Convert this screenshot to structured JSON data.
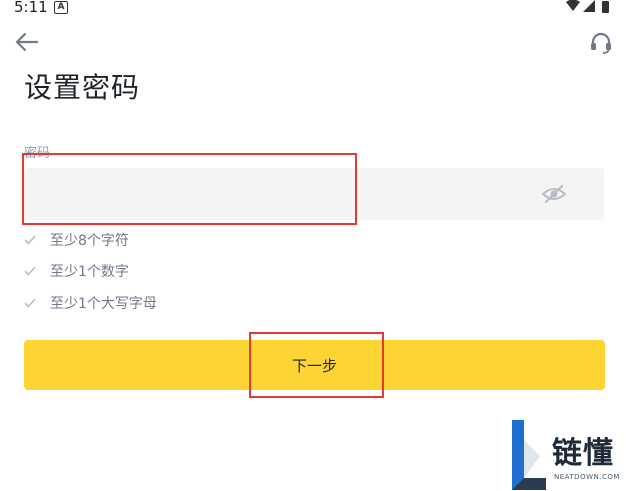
{
  "status_bar": {
    "time": "5:11",
    "notification_badge": "A"
  },
  "header": {
    "back_icon": "arrow-left-icon",
    "support_icon": "headset-icon",
    "title": "设置密码"
  },
  "form": {
    "password_label": "密码",
    "password_value": "",
    "eye_icon": "eye-off-icon"
  },
  "requirements": [
    {
      "label": "至少8个字符",
      "icon": "check-icon"
    },
    {
      "label": "至少1个数字",
      "icon": "check-icon"
    },
    {
      "label": "至少1个大写字母",
      "icon": "check-icon"
    }
  ],
  "actions": {
    "next_label": "下一步"
  },
  "colors": {
    "accent": "#fcd535",
    "highlight_box": "#e53935",
    "field_background": "#f4f4f4",
    "muted_text": "#707a8a"
  },
  "watermark": {
    "text": "链懂",
    "subtext": "NEATDOWN.COM"
  }
}
